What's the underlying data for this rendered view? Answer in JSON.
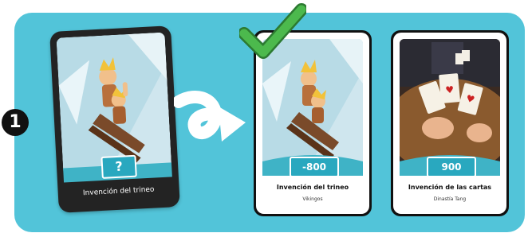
{
  "step": {
    "number": "1"
  },
  "mystery_card": {
    "value_label": "?",
    "name": "Invención del trineo"
  },
  "revealed_card": {
    "value": "-800",
    "name": "Invención del trineo",
    "civilization": "Vikingos",
    "status_icon": "green-checkmark-icon"
  },
  "reference_card": {
    "value": "900",
    "name": "Invención de las cartas",
    "civilization": "Dinastía Tang"
  },
  "colors": {
    "panel": "#52c4d9",
    "badge": "#29a8bf",
    "check": "#3fae49",
    "card_dark": "#232323"
  }
}
